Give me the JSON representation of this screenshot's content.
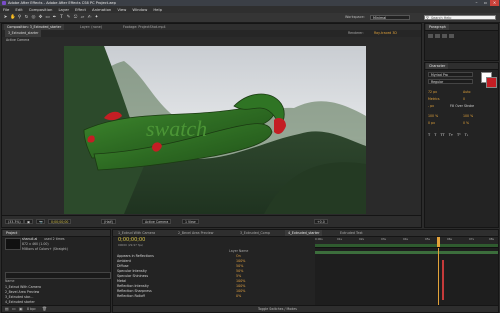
{
  "window": {
    "title": "Adobe After Effects - Adobe After Effects CS6 PC Project.aep"
  },
  "menu": [
    "File",
    "Edit",
    "Composition",
    "Layer",
    "Effect",
    "Animation",
    "View",
    "Window",
    "Help"
  ],
  "toolbar": {
    "workspace_label": "Workspace:",
    "workspace_value": "Minimal",
    "search_placeholder": "Search Help"
  },
  "viewer": {
    "tabs": [
      "Composition: 3_Extruded_starter",
      "Layer: (none)",
      "Footage: ProjectShot.mp4"
    ],
    "sub_tab": "3_Extruded_starter",
    "renderer_label": "Renderer:",
    "renderer_value": "Ray-traced 3D",
    "camera_label": "Active Camera",
    "text": "swatch",
    "status": {
      "zoom": "(33.3%)",
      "time": "0;00;00;00",
      "quality": "(Half)",
      "camera": "Active Camera",
      "view": "1 View",
      "offset": "+0.0"
    }
  },
  "right_panels": {
    "paragraph_tab": "Paragraph",
    "character_tab": "Character",
    "font": "Myriad Pro",
    "style": "Regular",
    "fields": [
      {
        "icon": "font-size-icon",
        "value": "72 px"
      },
      {
        "icon": "leading-icon",
        "value": "Auto"
      },
      {
        "icon": "kerning-icon",
        "value": "Metrics"
      },
      {
        "icon": "tracking-icon",
        "value": "0"
      },
      {
        "icon": "stroke-width-icon",
        "value": "- px"
      },
      {
        "icon": "fill-stroke-icon",
        "value": "Fill Over Stroke"
      },
      {
        "icon": "vertical-scale-icon",
        "value": "100 %"
      },
      {
        "icon": "horizontal-scale-icon",
        "value": "100 %"
      },
      {
        "icon": "baseline-icon",
        "value": "0 px"
      },
      {
        "icon": "tsume-icon",
        "value": "0 %"
      }
    ],
    "style_buttons": [
      "T",
      "T",
      "TT",
      "Tт",
      "T¹",
      "T₁"
    ]
  },
  "project": {
    "tab": "Project",
    "selected_item": "shanuli.ai",
    "selected_info": "used 2 times",
    "selected_size": "872 x 460 (1.00)",
    "selected_colors": "Millions of Colors+ (Straight)",
    "search_placeholder": "",
    "name_header": "Name",
    "items": [
      "1_Extrud With Camera",
      "2_Bevel Area Preview",
      "3_Extruded star…",
      "4_Extruded starter"
    ],
    "bpc": "8 bpc"
  },
  "timeline": {
    "tabs": [
      "1_Extrud With Camera",
      "2_Bevel Area Preview",
      "3_Extruded_Comp",
      "4_Extruded_starter",
      "Extruded Text"
    ],
    "timecode": "0;00;00;00",
    "fps": "00000 (29.97 fps)",
    "layer_header": "Layer Name",
    "layers": [
      {
        "name": "Appears in Reflections",
        "value": "On"
      },
      {
        "name": "Ambient",
        "value": "100%"
      },
      {
        "name": "Diffuse",
        "value": "50%"
      },
      {
        "name": "Specular Intensity",
        "value": "50%"
      },
      {
        "name": "Specular Shininess",
        "value": "5%"
      },
      {
        "name": "Metal",
        "value": "100%"
      },
      {
        "name": "Reflection Intensity",
        "value": "100%"
      },
      {
        "name": "Reflection Sharpness",
        "value": "100%"
      },
      {
        "name": "Reflection Rolloff",
        "value": "0%"
      }
    ],
    "ruler": [
      "0:00s",
      "01s",
      "02s",
      "03s",
      "04s",
      "05s",
      "06s",
      "07s",
      "08s"
    ],
    "footer": "Toggle Switches / Modes"
  },
  "colors": {
    "accent": "#e3a33a",
    "timecode": "#d8c44b",
    "work_area": "#2f5b2f",
    "keyframe": "#c43a3a"
  }
}
